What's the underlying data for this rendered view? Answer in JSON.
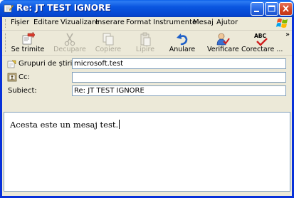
{
  "window": {
    "title": "Re: JT TEST IGNORE"
  },
  "menu": [
    "Fișier",
    "Editare",
    "Vizualizare",
    "Inserare",
    "Format",
    "Instrumente",
    "Mesaj",
    "Ajutor"
  ],
  "toolbar": {
    "send": "Se trimite",
    "cut": "Decupare",
    "copy": "Copiere",
    "paste": "Lipire",
    "undo": "Anulare",
    "check": "Verificare",
    "spelling": "Corectare ...",
    "more": "»"
  },
  "headers": {
    "newsgroups_label": "Grupuri de știri:",
    "newsgroups_value": "microsoft.test",
    "cc_label": "Cc:",
    "cc_value": "",
    "subject_label": "Subiect:",
    "subject_value": "Re: JT TEST IGNORE"
  },
  "message": {
    "body": "Acesta este un mesaj test."
  },
  "colors": {
    "titlebar": "#0a56e0",
    "chrome": "#ece9d8",
    "field_border": "#7f9db9"
  }
}
